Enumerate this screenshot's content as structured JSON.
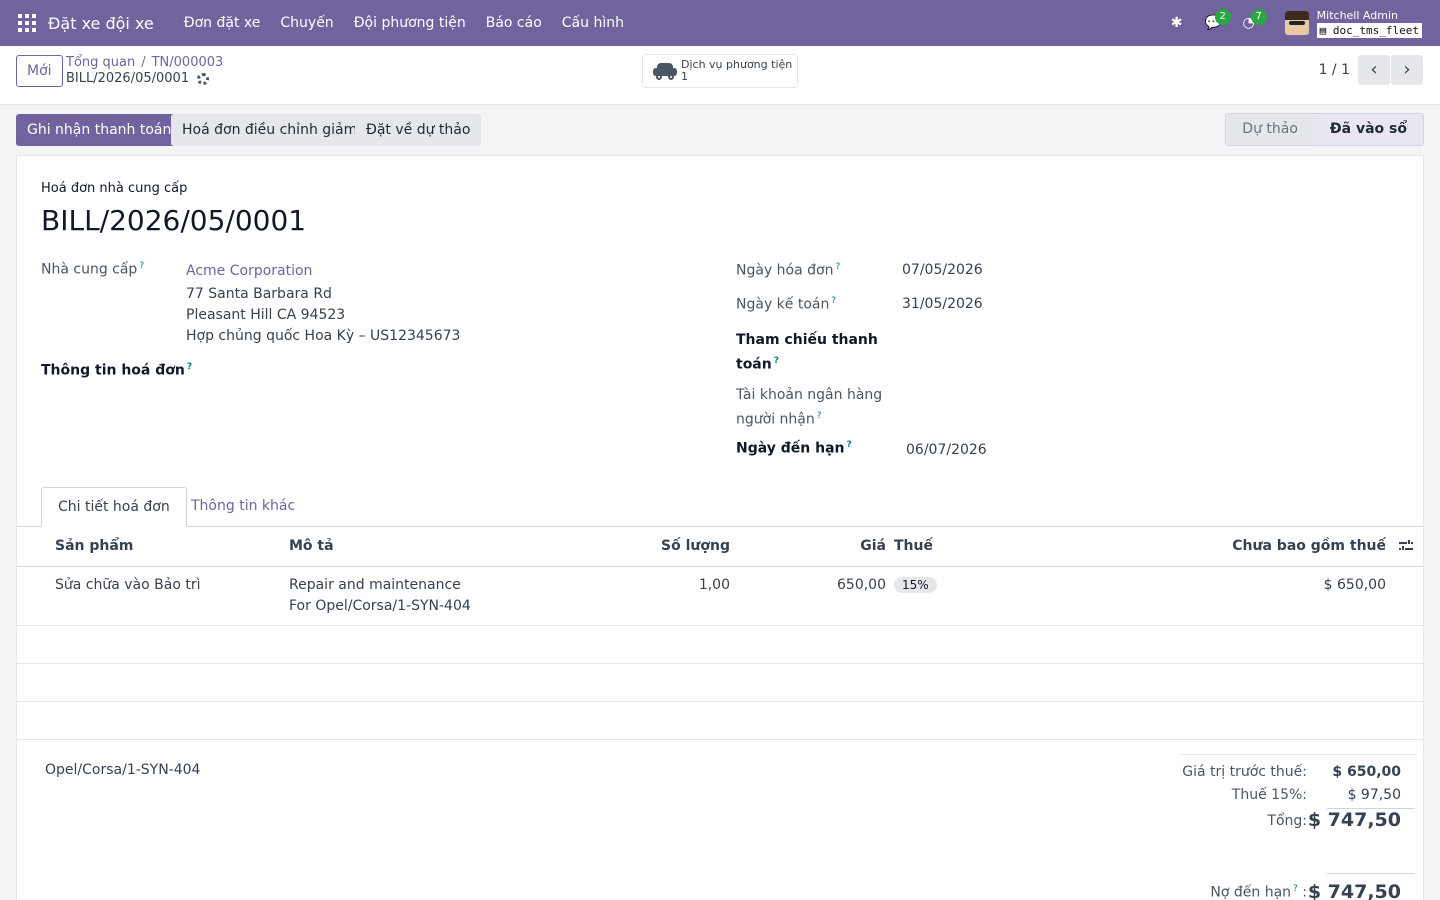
{
  "navbar": {
    "app_title": "Đặt xe đội xe",
    "menu": [
      "Đơn đặt xe",
      "Chuyến",
      "Đội phương tiện",
      "Báo cáo",
      "Cấu hình"
    ],
    "messages_count": "2",
    "activities_count": "7",
    "user_name": "Mitchell Admin",
    "db_name": "doc_tms_fleet",
    "accent_color": "#71639e"
  },
  "control": {
    "new_label": "Mới",
    "breadcrumb": [
      "Tổng quan",
      "TN/000003"
    ],
    "record_name": "BILL/2026/05/0001",
    "smart_button": {
      "label": "Dịch vụ phương tiện",
      "count": "1",
      "icon": "car-icon"
    },
    "pager": "1 / 1"
  },
  "actions": {
    "register_payment": "Ghi nhận thanh toán",
    "credit_note": "Hoá đơn điều chỉnh giảm",
    "reset_draft": "Đặt về dự thảo",
    "status": [
      "Dự thảo",
      "Đã vào sổ"
    ],
    "current_status": "Đã vào sổ"
  },
  "invoice": {
    "move_type": "Hoá đơn nhà cung cấp",
    "name": "BILL/2026/05/0001",
    "vendor_label": "Nhà cung cấp",
    "vendor_name": "Acme Corporation",
    "vendor_address": [
      "77 Santa Barbara Rd",
      "Pleasant Hill CA 94523",
      "Hợp chủng quốc Hoa Kỳ – US12345673"
    ],
    "bill_ref_label": "Thông tin hoá đơn",
    "invoice_date_label": "Ngày hóa đơn",
    "invoice_date": "07/05/2026",
    "accounting_date_label": "Ngày kế toán",
    "accounting_date": "31/05/2026",
    "payment_ref_label_1": "Tham chiếu thanh",
    "payment_ref_label_2": "toán",
    "bank_label_1": "Tài khoản ngân hàng",
    "bank_label_2": "người nhận",
    "due_date_label": "Ngày đến hạn",
    "due_date": "06/07/2026",
    "q_mark": "?"
  },
  "tabs": [
    "Chi tiết hoá đơn",
    "Thông tin khác"
  ],
  "lines": {
    "headers": {
      "product": "Sản phẩm",
      "description": "Mô tả",
      "quantity": "Số lượng",
      "price": "Giá",
      "tax": "Thuế",
      "subtotal": "Chưa bao gồm thuế"
    },
    "rows": [
      {
        "product": "Sửa chữa vào Bảo trì",
        "description_1": "Repair and maintenance",
        "description_2": "For Opel/Corsa/1-SYN-404",
        "quantity": "1,00",
        "price": "650,00",
        "tax": "15%",
        "subtotal": "$ 650,00"
      }
    ]
  },
  "narration": "Opel/Corsa/1-SYN-404",
  "totals": {
    "untaxed_label": "Giá trị trước thuế:",
    "untaxed": "$ 650,00",
    "tax_label": "Thuế 15%:",
    "tax": "$ 97,50",
    "total_label": "Tổng:",
    "total": "$ 747,50",
    "due_label": "Nợ đến hạn",
    "due": "$ 747,50"
  }
}
